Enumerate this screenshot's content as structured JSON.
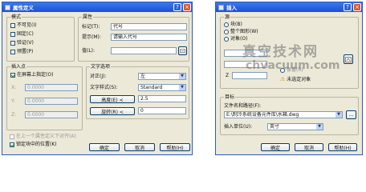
{
  "dialog1": {
    "title": "属性定义",
    "mode": {
      "label": "模式",
      "items": [
        {
          "label": "不可见(I)",
          "checked": false
        },
        {
          "label": "固定(C)",
          "checked": false
        },
        {
          "label": "验证(V)",
          "checked": false
        },
        {
          "label": "预置(P)",
          "checked": false
        }
      ]
    },
    "attribute": {
      "label": "属性",
      "tag_label": "标记(T):",
      "tag_value": "代号",
      "prompt_label": "提示(M):",
      "prompt_value": "请输入代号",
      "value_label": "值(L):",
      "value_value": ""
    },
    "insertion": {
      "label": "插入点",
      "onscreen_label": "在屏幕上指定(O)",
      "onscreen_checked": true,
      "x_label": "X:",
      "x_value": "0.0000",
      "y_label": "Y:",
      "y_value": "0.0000",
      "z_label": "Z:",
      "z_value": "0.0000"
    },
    "text_options": {
      "label": "文字选项",
      "justify_label": "对正(J):",
      "justify_value": "左",
      "style_label": "文字样式(S):",
      "style_value": "Standard",
      "height_button": "高度(E) <",
      "height_value": "2.5",
      "rotation_button": "旋转(R) <",
      "rotation_value": "0"
    },
    "align_below": "在上一个属性定义下对齐(A)",
    "lock_position": "锁定块中的位置(K)",
    "buttons": {
      "ok": "确定",
      "cancel": "取消",
      "help": "帮助(H)"
    }
  },
  "dialog2": {
    "title": "插入",
    "source_label": "源",
    "radios": [
      "块(B)",
      "整个图形(W)",
      "对象(O)"
    ],
    "object_checkbox": "保留(R)",
    "unspecified_label": "未选定对象",
    "target_label": "目标",
    "path_label": "文件名和路径(F):",
    "path_value": "E:\\制冷系统设备元件库\\水箱.dwg",
    "browse_button": "...",
    "units_label": "插入单位(U):",
    "units_value": "英寸",
    "buttons": {
      "ok": "确定",
      "cancel": "取消",
      "help": "帮助(H)"
    }
  },
  "watermark": {
    "title": "真空技术网",
    "url": "chvacuum.com"
  }
}
